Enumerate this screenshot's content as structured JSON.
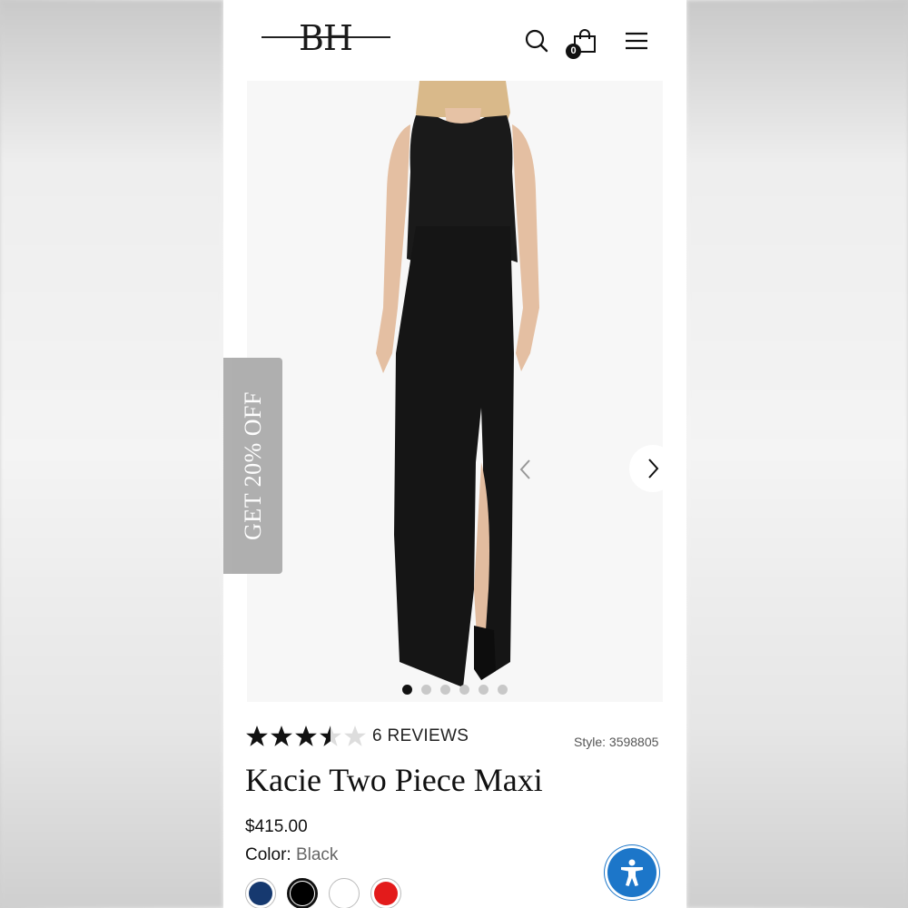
{
  "header": {
    "logo_text": "BH",
    "cart_count": "0"
  },
  "gallery": {
    "promo_label": "GET 20% OFF",
    "slide_count": 6,
    "active_slide": 1
  },
  "product": {
    "rating": 3.5,
    "rating_max": 5,
    "reviews_label": "6 REVIEWS",
    "style_label": "Style: 3598805",
    "title": "Kacie Two Piece Maxi",
    "price": "$415.00",
    "color_label": "Color:",
    "color_value": "Black",
    "swatches": [
      {
        "name": "navy",
        "color": "#16396f"
      },
      {
        "name": "black",
        "color": "#000000",
        "selected": true
      },
      {
        "name": "white",
        "color": "#ffffff"
      },
      {
        "name": "red",
        "color": "#e31b1b"
      }
    ]
  },
  "colors": {
    "accent_blue": "#1c76c9",
    "promo_tab": "#a9a9a9"
  }
}
